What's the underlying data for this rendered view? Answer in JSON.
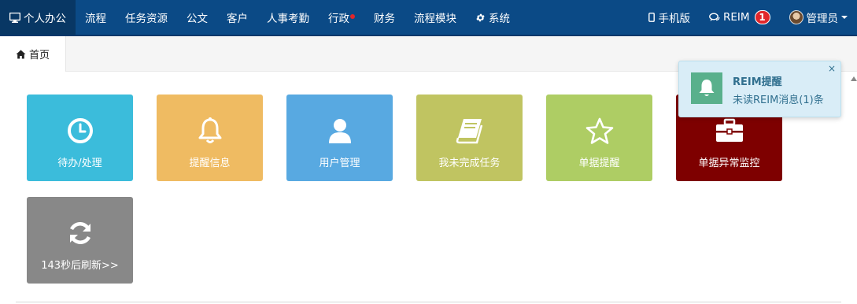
{
  "navbar": {
    "left_items": [
      {
        "label": "个人办公",
        "icon": "monitor-icon"
      },
      {
        "label": "流程"
      },
      {
        "label": "任务资源"
      },
      {
        "label": "公文"
      },
      {
        "label": "客户"
      },
      {
        "label": "人事考勤"
      },
      {
        "label": "行政",
        "dot_color": "#e0262b"
      },
      {
        "label": "财务"
      },
      {
        "label": "流程模块"
      },
      {
        "label": "系统",
        "icon": "gear-icon"
      }
    ],
    "mobile_label": "手机版",
    "reim_label": "REIM",
    "reim_badge": "1",
    "user_label": "管理员"
  },
  "tabs": {
    "home_label": "首页",
    "home_icon": "home-icon"
  },
  "tiles": [
    {
      "label": "待办/处理",
      "icon": "clock-icon",
      "color": "#3bbcdb"
    },
    {
      "label": "提醒信息",
      "icon": "bell-icon",
      "color": "#efbb62"
    },
    {
      "label": "用户管理",
      "icon": "user-icon",
      "color": "#58a9e1"
    },
    {
      "label": "我未完成任务",
      "icon": "book-icon",
      "color": "#c0c461"
    },
    {
      "label": "单据提醒",
      "icon": "star-icon",
      "color": "#aecd64"
    },
    {
      "label": "单据异常监控",
      "icon": "briefcase-icon",
      "color": "#7e0000"
    },
    {
      "label": "143秒后刷新>>",
      "icon": "refresh-icon",
      "color": "#888888"
    }
  ],
  "notification": {
    "title": "REIM提醒",
    "message": "未读REIM消息(1)条",
    "close": "×",
    "icon": "bell-icon",
    "background": "#d9edf7"
  }
}
